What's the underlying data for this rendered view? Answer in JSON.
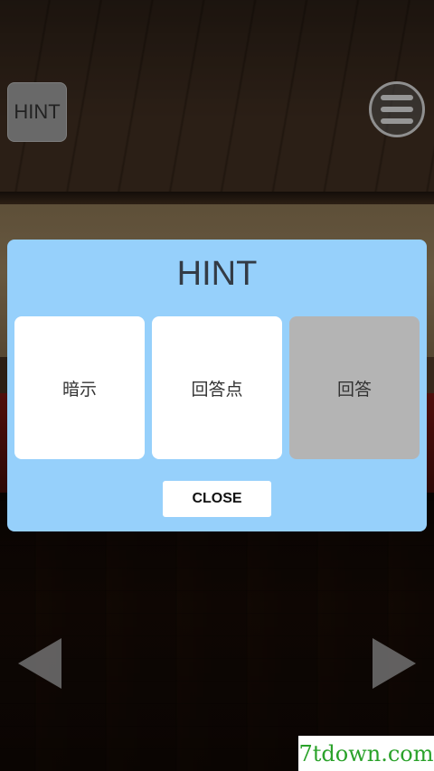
{
  "hud": {
    "hint_label": "HINT"
  },
  "dialog": {
    "title": "HINT",
    "options": [
      {
        "label": "暗示",
        "enabled": true
      },
      {
        "label": "回答点",
        "enabled": true
      },
      {
        "label": "回答",
        "enabled": false
      }
    ],
    "close_label": "CLOSE"
  },
  "watermark": "7tdown.com",
  "colors": {
    "dialog_bg": "#96d0fb",
    "option_enabled": "#ffffff",
    "option_disabled": "#b4b4b4",
    "watermark_text": "#2aa22a"
  },
  "icons": {
    "menu": "menu-icon",
    "left": "arrow-left-icon",
    "right": "arrow-right-icon"
  }
}
